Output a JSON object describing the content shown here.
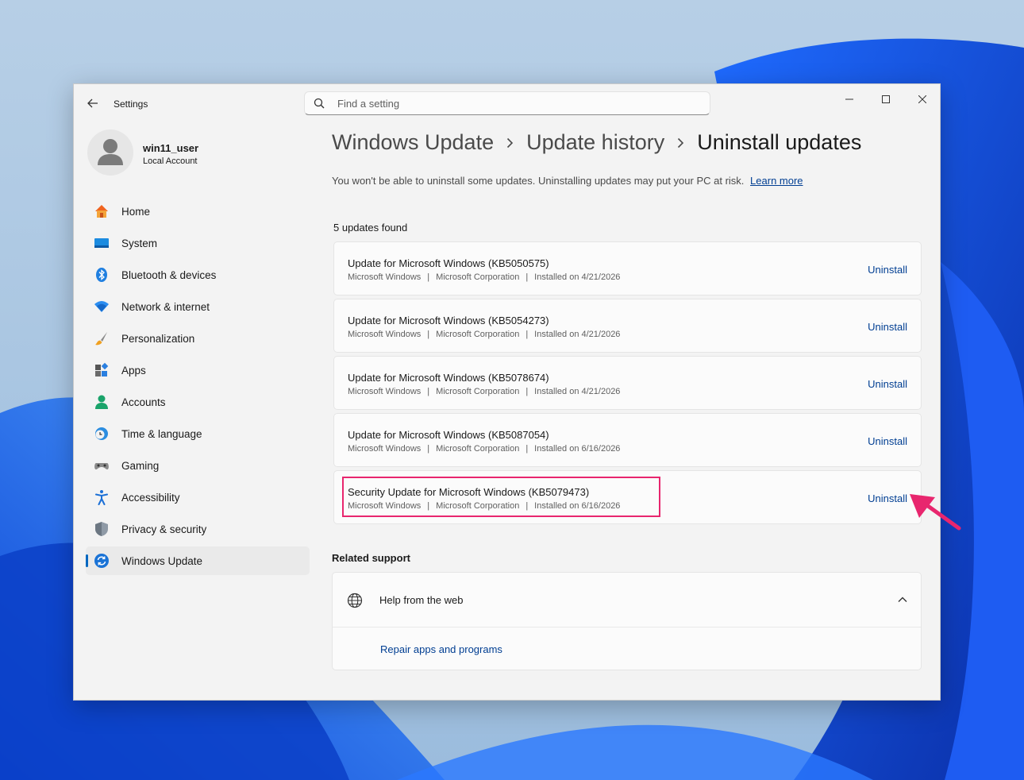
{
  "window": {
    "app_title": "Settings",
    "search": {
      "placeholder": "Find a setting",
      "value": ""
    }
  },
  "user": {
    "name": "win11_user",
    "account_type": "Local Account"
  },
  "sidebar": {
    "items": [
      {
        "label": "Home",
        "icon": "home-icon",
        "active": false
      },
      {
        "label": "System",
        "icon": "system-icon",
        "active": false
      },
      {
        "label": "Bluetooth & devices",
        "icon": "bluetooth-icon",
        "active": false
      },
      {
        "label": "Network & internet",
        "icon": "wifi-icon",
        "active": false
      },
      {
        "label": "Personalization",
        "icon": "brush-icon",
        "active": false
      },
      {
        "label": "Apps",
        "icon": "apps-icon",
        "active": false
      },
      {
        "label": "Accounts",
        "icon": "accounts-icon",
        "active": false
      },
      {
        "label": "Time & language",
        "icon": "clock-globe-icon",
        "active": false
      },
      {
        "label": "Gaming",
        "icon": "gamepad-icon",
        "active": false
      },
      {
        "label": "Accessibility",
        "icon": "accessibility-icon",
        "active": false
      },
      {
        "label": "Privacy & security",
        "icon": "shield-icon",
        "active": false
      },
      {
        "label": "Windows Update",
        "icon": "update-icon",
        "active": true
      }
    ]
  },
  "breadcrumb": {
    "items": [
      "Windows Update",
      "Update history"
    ],
    "current": "Uninstall updates"
  },
  "warning": {
    "text": "You won't be able to uninstall some updates. Uninstalling updates may put your PC at risk.",
    "link": "Learn more"
  },
  "updates": {
    "count_text": "5 updates found",
    "action_label": "Uninstall",
    "items": [
      {
        "title": "Update for Microsoft Windows (KB5050575)",
        "product": "Microsoft Windows",
        "publisher": "Microsoft Corporation",
        "installed": "Installed on 4/21/2026"
      },
      {
        "title": "Update for Microsoft Windows (KB5054273)",
        "product": "Microsoft Windows",
        "publisher": "Microsoft Corporation",
        "installed": "Installed on 4/21/2026"
      },
      {
        "title": "Update for Microsoft Windows (KB5078674)",
        "product": "Microsoft Windows",
        "publisher": "Microsoft Corporation",
        "installed": "Installed on 4/21/2026"
      },
      {
        "title": "Update for Microsoft Windows (KB5087054)",
        "product": "Microsoft Windows",
        "publisher": "Microsoft Corporation",
        "installed": "Installed on 6/16/2026"
      },
      {
        "title": "Security Update for Microsoft Windows (KB5079473)",
        "product": "Microsoft Windows",
        "publisher": "Microsoft Corporation",
        "installed": "Installed on 6/16/2026"
      }
    ]
  },
  "related_support": {
    "title": "Related support",
    "help_label": "Help from the web",
    "links": [
      "Repair apps and programs"
    ]
  },
  "colors": {
    "accent": "#0067c0",
    "link": "#003e92",
    "highlight": "#e8266e"
  }
}
